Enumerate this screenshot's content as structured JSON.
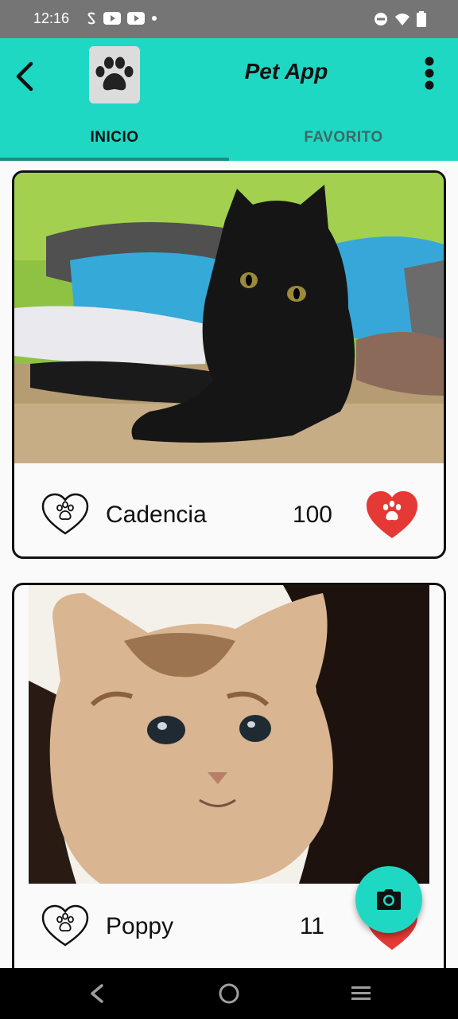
{
  "status_bar": {
    "time": "12:16"
  },
  "app_bar": {
    "title": "Pet App",
    "tabs": [
      {
        "label": "INICIO",
        "active": true
      },
      {
        "label": "FAVORITO",
        "active": false
      }
    ]
  },
  "pets": [
    {
      "name": "Cadencia",
      "count": "100",
      "photo": "black-kitten"
    },
    {
      "name": "Poppy",
      "count": "11",
      "photo": "tabby-kitten"
    }
  ],
  "colors": {
    "primary": "#1fd8c4",
    "tab_indicator": "#1c8c84",
    "like": "#e53935"
  },
  "icons": {
    "back": "back-arrow-icon",
    "logo": "paw-icon",
    "menu": "more-vert-icon",
    "pet_heart": "heart-paw-outline-icon",
    "like": "heart-paw-filled-icon",
    "fab": "camera-icon"
  }
}
